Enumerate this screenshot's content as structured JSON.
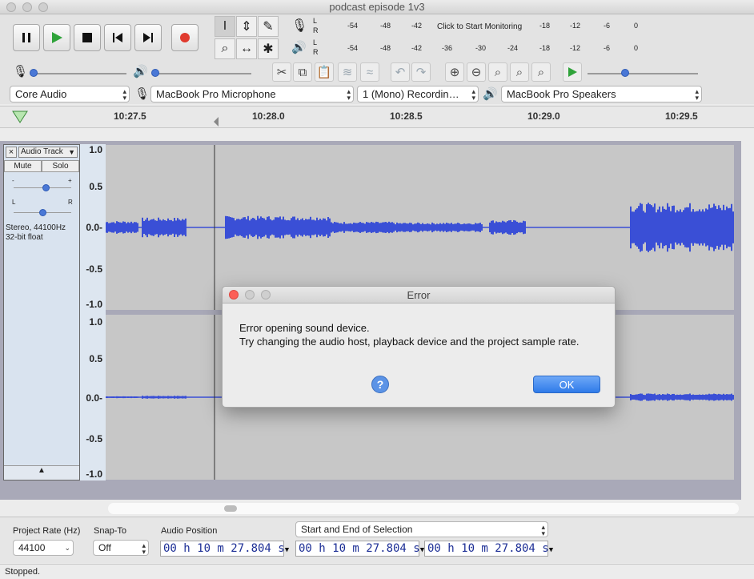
{
  "window": {
    "title": "podcast episode 1v3"
  },
  "meters": {
    "rec_ticks": [
      "-54",
      "-48",
      "-42",
      "-18",
      "-12",
      "-6",
      "0"
    ],
    "monitor_prompt": "Click to Start Monitoring",
    "play_ticks": [
      "-54",
      "-48",
      "-42",
      "-36",
      "-30",
      "-24",
      "-18",
      "-12",
      "-6",
      "0"
    ],
    "channel_l": "L",
    "channel_r": "R"
  },
  "devices": {
    "host": "Core Audio",
    "input": "MacBook Pro Microphone",
    "channels": "1 (Mono) Recordin…",
    "output": "MacBook Pro Speakers"
  },
  "ruler": {
    "labels": [
      "10:27.5",
      "10:28.0",
      "10:28.5",
      "10:29.0",
      "10:29.5"
    ]
  },
  "track": {
    "name": "Audio Track",
    "mute": "Mute",
    "solo": "Solo",
    "info_line1": "Stereo, 44100Hz",
    "info_line2": "32-bit float",
    "close": "×",
    "gain_minus": "-",
    "gain_plus": "+",
    "pan_left": "L",
    "pan_right": "R",
    "gain_level": 0.55,
    "pan_level": 0.5,
    "y_labels": [
      "1.0",
      "0.5",
      "0.0-",
      "-0.5",
      "-1.0"
    ],
    "y_labels_2": [
      "1.0",
      "0.5",
      "0.0-",
      "-0.5",
      "-1.0"
    ]
  },
  "dialog": {
    "title": "Error",
    "line1": "Error opening sound device.",
    "line2": "Try changing the audio host, playback device and the project sample rate.",
    "help": "?",
    "ok": "OK"
  },
  "bottom": {
    "rate_label": "Project Rate (Hz)",
    "rate_value": "44100",
    "snap_label": "Snap-To",
    "snap_value": "Off",
    "pos_label": "Audio Position",
    "sel_mode": "Start and End of Selection",
    "audio_position": "00 h 10 m 27.804 s",
    "sel_start": "00 h 10 m 27.804 s",
    "sel_end": "00 h 10 m 27.804 s"
  },
  "status": {
    "text": "Stopped."
  },
  "icons": {
    "pause": "pause-icon",
    "play": "play-icon",
    "stop": "stop-icon",
    "skip_start": "skip-start-icon",
    "skip_end": "skip-end-icon",
    "record": "record-icon"
  },
  "colors": {
    "waveform": "#3a4fd6",
    "record": "#e03a2e",
    "play": "#2fa33a",
    "ok_button": "#2f7be9"
  }
}
